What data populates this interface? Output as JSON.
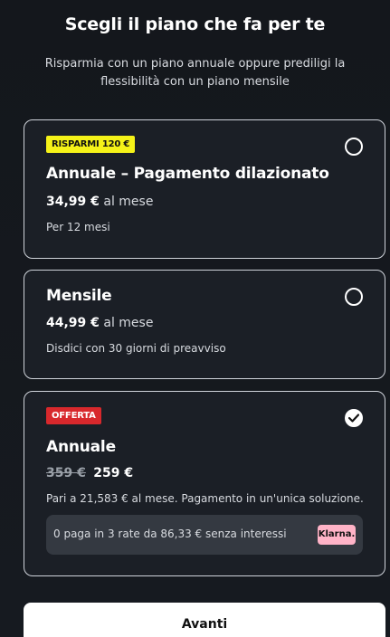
{
  "header": {
    "title": "Scegli il piano che fa per te",
    "subtitle": "Risparmia con un piano annuale oppure prediligi la flessibilità con un piano mensile"
  },
  "plans": [
    {
      "badge": "RISPARMI 120 €",
      "badge_color": "#f5f218",
      "title": "Annuale – Pagamento dilazionato",
      "price": "34,99 €",
      "price_suffix": "al mese",
      "note": "Per 12 mesi",
      "selected": false
    },
    {
      "title": "Mensile",
      "price": "44,99 €",
      "price_suffix": "al mese",
      "note": "Disdici con 30 giorni di preavviso",
      "selected": false
    },
    {
      "badge": "OFFERTA",
      "badge_color": "#d8282c",
      "title": "Annuale",
      "old_price": "359 €",
      "price": "259 €",
      "note": "Pari a 21,583 € al mese. Pagamento in un'unica soluzione.",
      "klarna_text": "0 paga in 3 rate da 86,33 € senza interessi",
      "klarna_logo": "Klarna.",
      "selected": true
    }
  ],
  "cta": {
    "label": "Avanti"
  },
  "icons": {
    "radio": "radio-empty-icon",
    "selected": "check-icon"
  }
}
